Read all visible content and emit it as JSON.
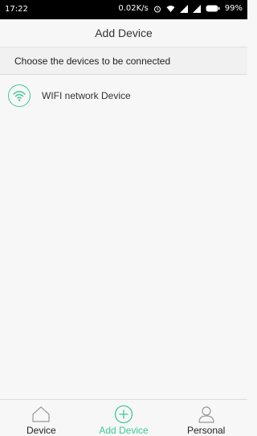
{
  "status_bar": {
    "time": "17:22",
    "speed": "0.02K/s",
    "battery": "99%",
    "icons": [
      "alarm-icon",
      "wifi-icon",
      "signal-icon",
      "signal-icon",
      "battery-icon"
    ]
  },
  "header": {
    "title": "Add Device"
  },
  "section": {
    "label": "Choose the devices to be connected"
  },
  "devices": [
    {
      "label": "WIFI network Device",
      "icon": "wifi-icon"
    }
  ],
  "tabs": [
    {
      "label": "Device",
      "icon": "home-icon",
      "active": false
    },
    {
      "label": "Add Device",
      "icon": "plus-circle-icon",
      "active": true
    },
    {
      "label": "Personal",
      "icon": "person-icon",
      "active": false
    }
  ],
  "colors": {
    "accent": "#3fc89b",
    "status_bar": "#000000",
    "background": "#f7f7f7"
  }
}
